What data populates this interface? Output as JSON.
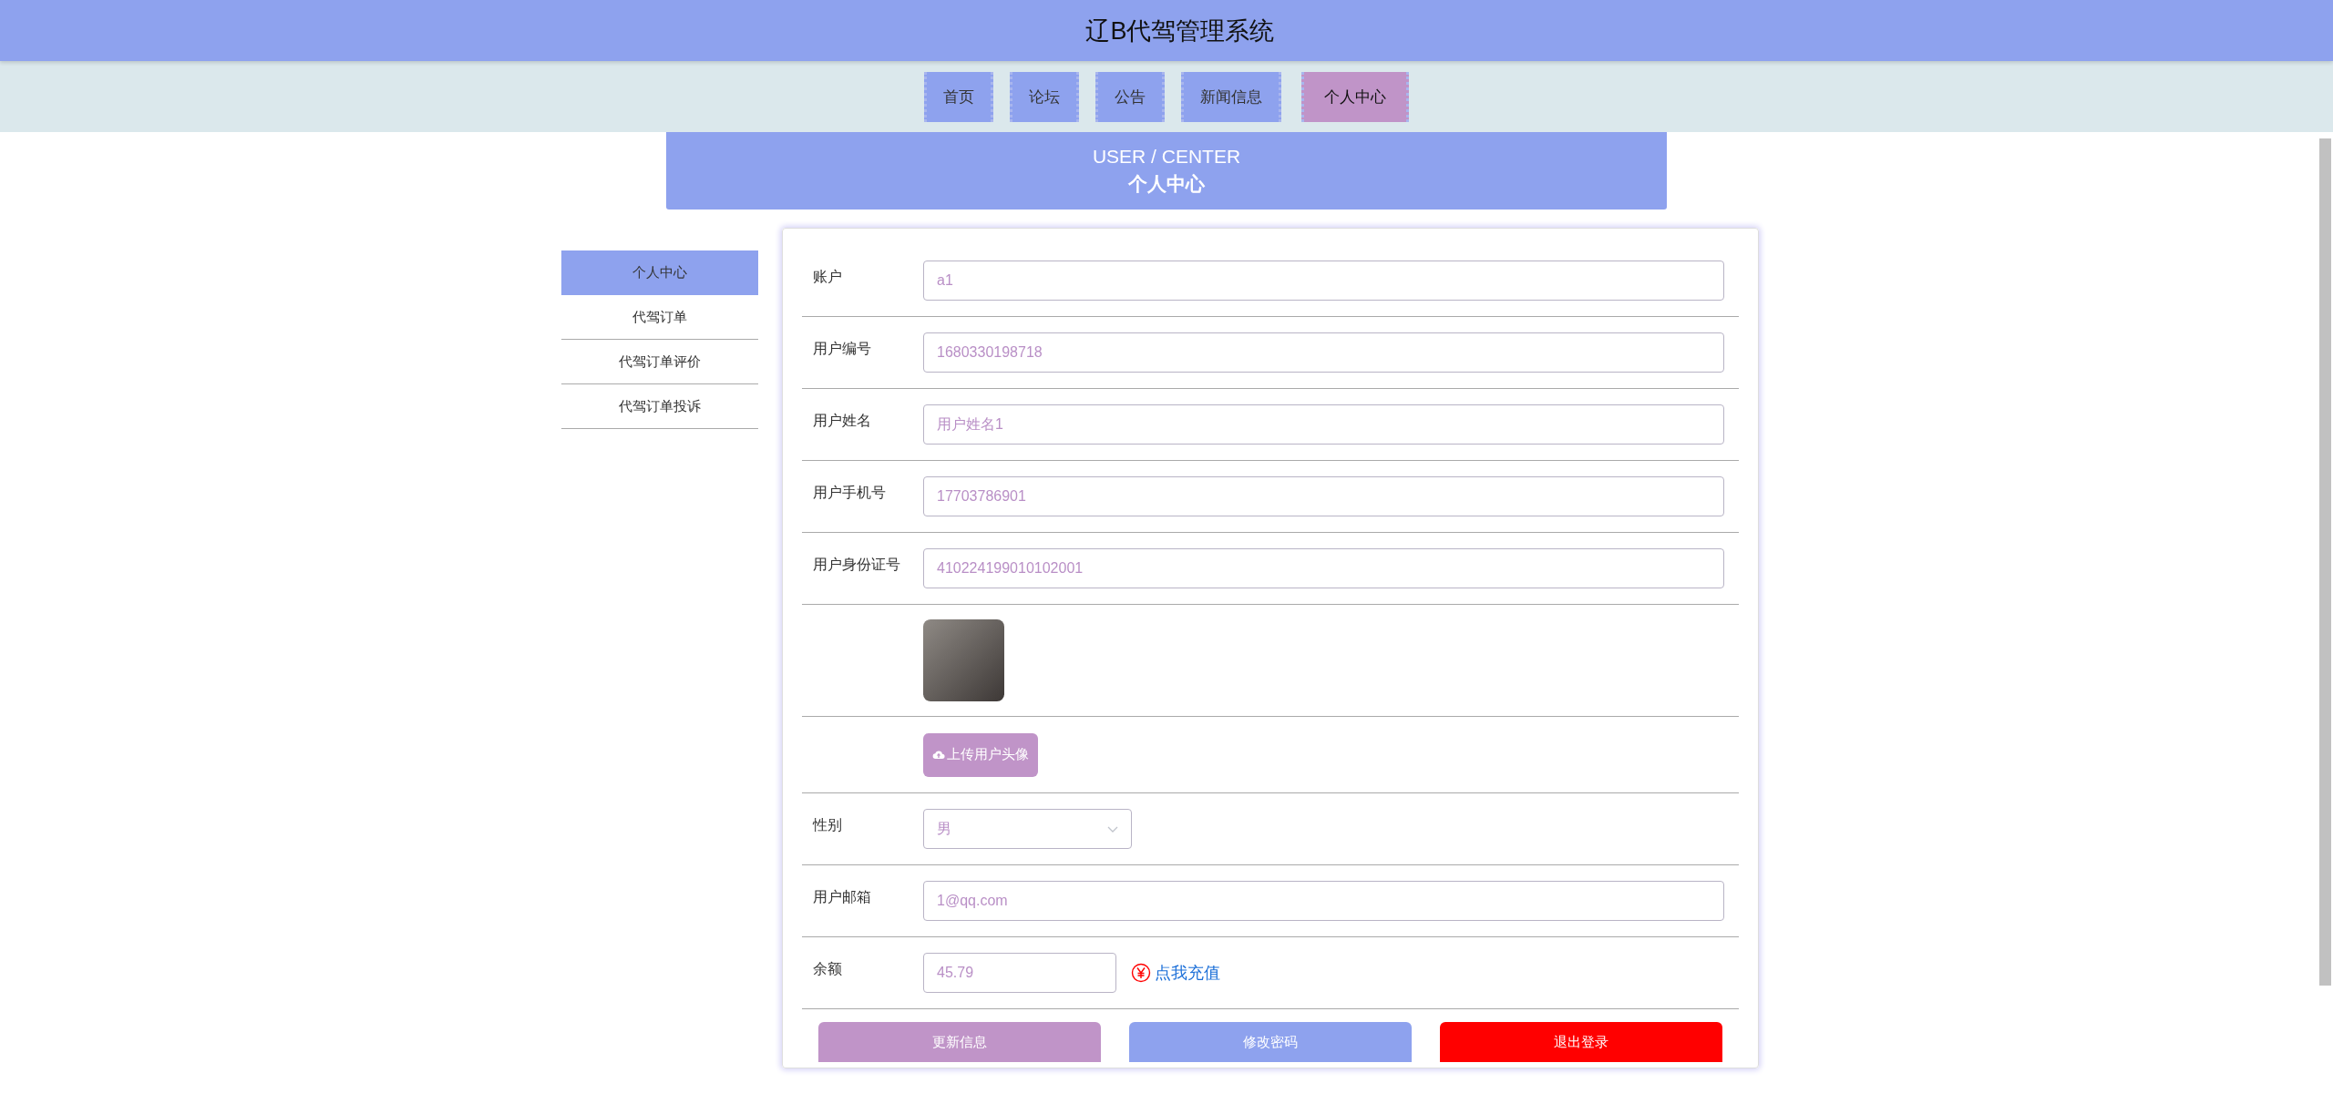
{
  "header": {
    "title": "辽B代驾管理系统"
  },
  "nav": [
    {
      "label": "首页",
      "selected": false
    },
    {
      "label": "论坛",
      "selected": false
    },
    {
      "label": "公告",
      "selected": false
    },
    {
      "label": "新闻信息",
      "selected": false
    },
    {
      "label": "个人中心",
      "selected": true
    }
  ],
  "banner": {
    "subtitle": "USER / CENTER",
    "title": "个人中心"
  },
  "sidebar": {
    "items": [
      {
        "label": "个人中心",
        "selected": true
      },
      {
        "label": "代驾订单",
        "selected": false
      },
      {
        "label": "代驾订单评价",
        "selected": false
      },
      {
        "label": "代驾订单投诉",
        "selected": false
      }
    ]
  },
  "form": {
    "fields": [
      {
        "kind": "text",
        "label": "账户",
        "value": "a1"
      },
      {
        "kind": "text",
        "label": "用户编号",
        "value": "1680330198718"
      },
      {
        "kind": "text",
        "label": "用户姓名",
        "value": "用户姓名1"
      },
      {
        "kind": "text",
        "label": "用户手机号",
        "value": "17703786901"
      },
      {
        "kind": "text",
        "label": "用户身份证号",
        "value": "410224199010102001"
      },
      {
        "kind": "image"
      },
      {
        "kind": "upload",
        "button": "上传用户头像"
      },
      {
        "kind": "select",
        "label": "性别",
        "value": "男"
      },
      {
        "kind": "text",
        "label": "用户邮箱",
        "value": "1@qq.com"
      },
      {
        "kind": "balance",
        "label": "余额",
        "value": "45.79",
        "link": "点我充值"
      }
    ]
  },
  "actions": [
    {
      "kind": "update",
      "label": "更新信息"
    },
    {
      "kind": "password",
      "label": "修改密码"
    },
    {
      "kind": "logout",
      "label": "退出登录"
    }
  ]
}
